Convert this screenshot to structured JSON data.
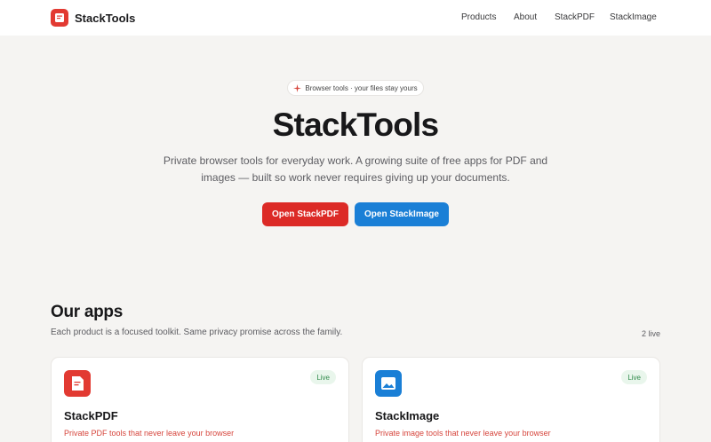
{
  "nav": {
    "brand": "StackTools",
    "links": [
      "Products",
      "About",
      "StackPDF",
      "StackImage"
    ]
  },
  "hero": {
    "pill": "Browser tools · your files stay yours",
    "title": "StackTools",
    "subtitle": "Private browser tools for everyday work. A growing suite of free apps for PDF and images — built so work never requires giving up your documents.",
    "primary_button": "Open StackPDF",
    "secondary_button": "Open StackImage"
  },
  "apps": {
    "title": "Our apps",
    "subtitle": "Each product is a focused toolkit. Same privacy promise across the family.",
    "count": "2 live",
    "cards": [
      {
        "name": "StackPDF",
        "badge": "Live",
        "description": "Private PDF tools that never leave your browser",
        "icon": "pdf-icon",
        "accent": "#e23a32",
        "desc_color": "#d6453c"
      },
      {
        "name": "StackImage",
        "badge": "Live",
        "description": "Private image tools that never leave your browser",
        "icon": "image-icon",
        "accent": "#1a7fd6",
        "desc_color": "#d6453c"
      }
    ]
  },
  "colors": {
    "pdf_red": "#dc2a26",
    "image_blue": "#1a7fd6",
    "live_green": "#2f8a4a",
    "background": "#f5f4f2"
  }
}
